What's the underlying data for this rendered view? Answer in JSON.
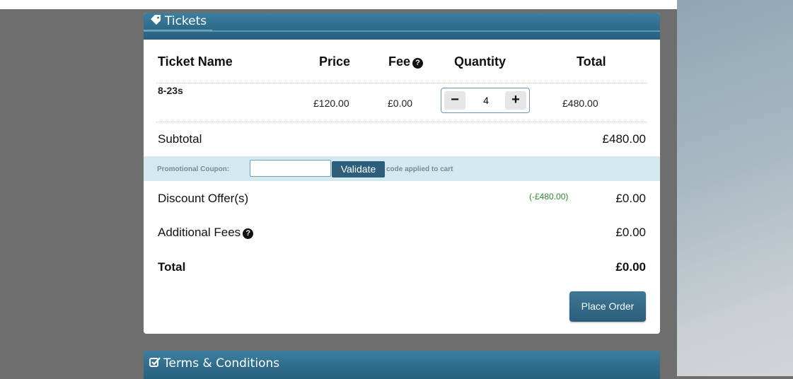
{
  "tickets_panel": {
    "title": "Tickets",
    "icon": "tag-icon",
    "columns": {
      "name": "Ticket Name",
      "price": "Price",
      "fee": "Fee",
      "quantity": "Quantity",
      "total": "Total"
    },
    "rows": [
      {
        "name": "8-23s",
        "price": "£120.00",
        "fee": "£0.00",
        "quantity": "4",
        "total": "£480.00"
      }
    ],
    "subtotal_label": "Subtotal",
    "subtotal_value": "£480.00",
    "coupon": {
      "label": "Promotional Coupon:",
      "input_value": "",
      "validate_label": "Validate",
      "status_text": "code applied to cart"
    },
    "discount_label": "Discount Offer(s)",
    "discount_note": "(-£480.00)",
    "discount_value": "£0.00",
    "fees_label": "Additional Fees",
    "fees_value": "£0.00",
    "total_label": "Total",
    "total_value": "£0.00",
    "place_order_label": "Place Order"
  },
  "terms_panel": {
    "title": "Terms & Conditions",
    "icon": "checkbox-icon"
  },
  "colors": {
    "header_blue": "#2f6c8c",
    "coupon_band": "#d3e9ef",
    "discount_green": "#2b8a2b",
    "button_blue": "#2d5f7a"
  }
}
